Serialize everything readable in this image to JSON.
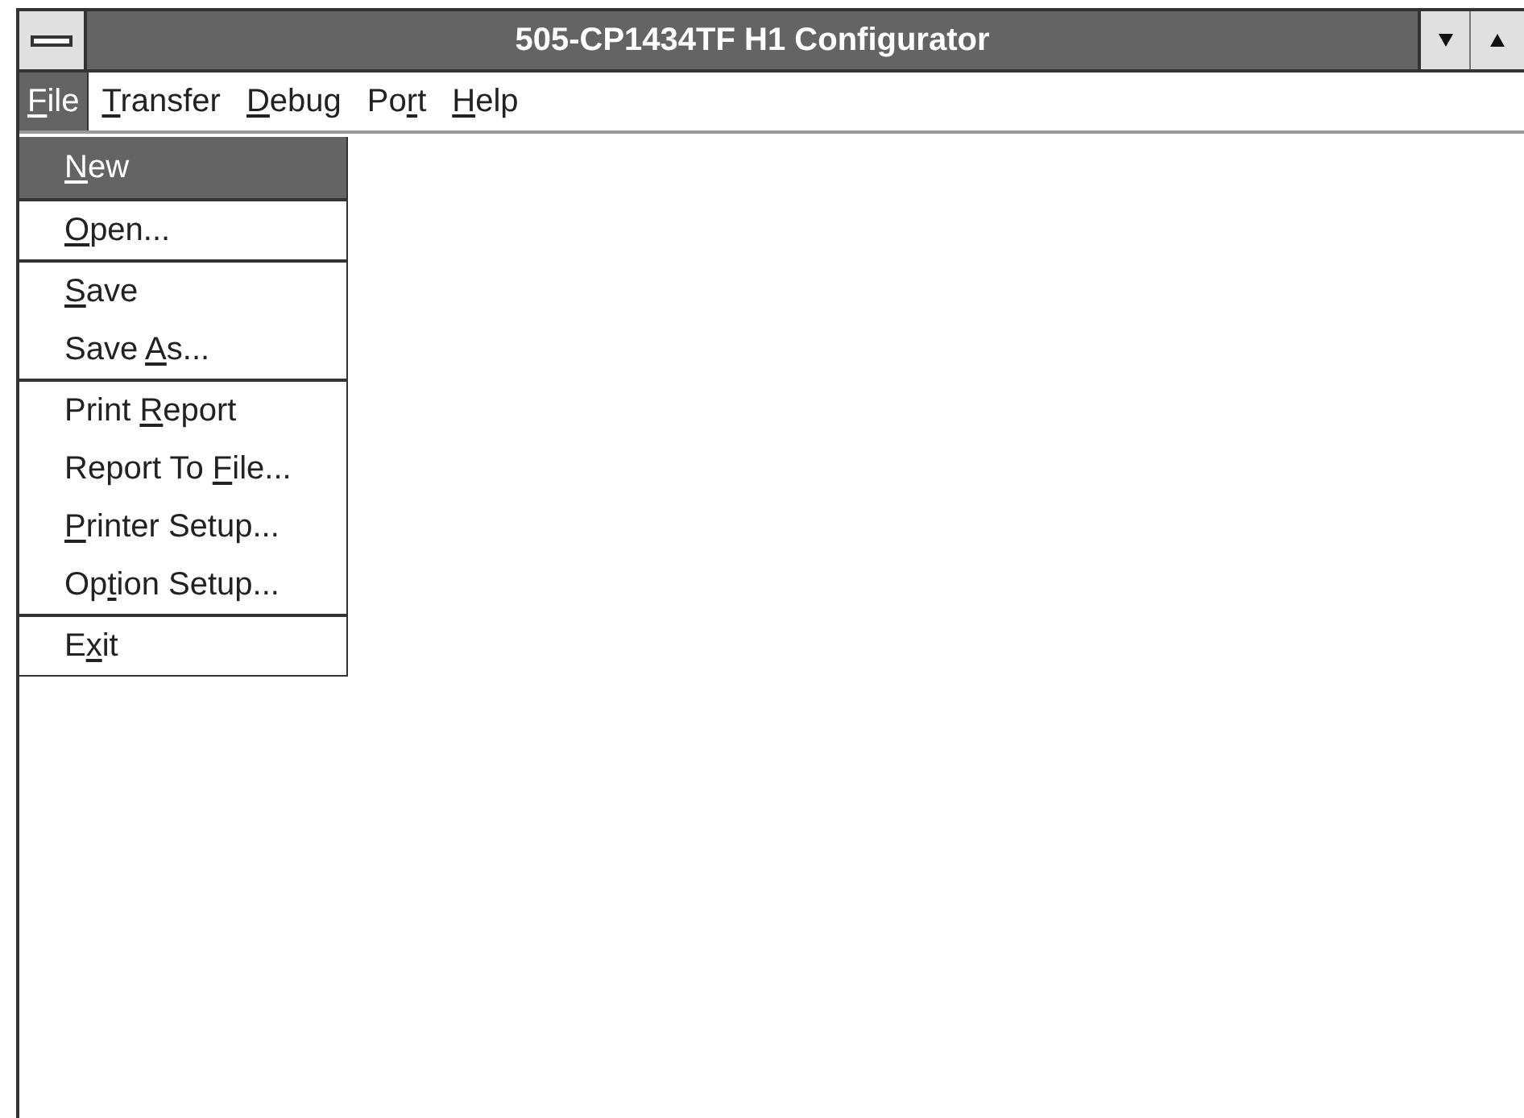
{
  "window": {
    "title": "505-CP1434TF H1 Configurator"
  },
  "menu_bar": [
    {
      "label": {
        "key": "F",
        "after": "ile"
      },
      "selected": true
    },
    {
      "label": {
        "key": "T",
        "after": "ransfer"
      },
      "selected": false
    },
    {
      "label": {
        "key": "D",
        "after": "ebug"
      },
      "selected": false
    },
    {
      "label": {
        "before": "Po",
        "key": "r",
        "after": "t"
      },
      "selected": false
    },
    {
      "label": {
        "key": "H",
        "after": "elp"
      },
      "selected": false
    }
  ],
  "file_menu": [
    [
      {
        "label": {
          "key": "N",
          "after": "ew"
        },
        "selected": true
      }
    ],
    [
      {
        "label": {
          "key": "O",
          "after": "pen..."
        },
        "selected": false
      }
    ],
    [
      {
        "label": {
          "key": "S",
          "after": "ave"
        },
        "selected": false
      },
      {
        "label": {
          "before": "Save ",
          "key": "A",
          "after": "s..."
        },
        "selected": false
      }
    ],
    [
      {
        "label": {
          "before": "Print ",
          "key": "R",
          "after": "eport"
        },
        "selected": false
      },
      {
        "label": {
          "before": "Report To ",
          "key": "F",
          "after": "ile..."
        },
        "selected": false
      },
      {
        "label": {
          "key": "P",
          "after": "rinter Setup..."
        },
        "selected": false
      },
      {
        "label": {
          "before": "Op",
          "key": "t",
          "after": "ion Setup..."
        },
        "selected": false
      }
    ],
    [
      {
        "label": {
          "before": "E",
          "key": "x",
          "after": "it"
        },
        "selected": false
      }
    ]
  ]
}
